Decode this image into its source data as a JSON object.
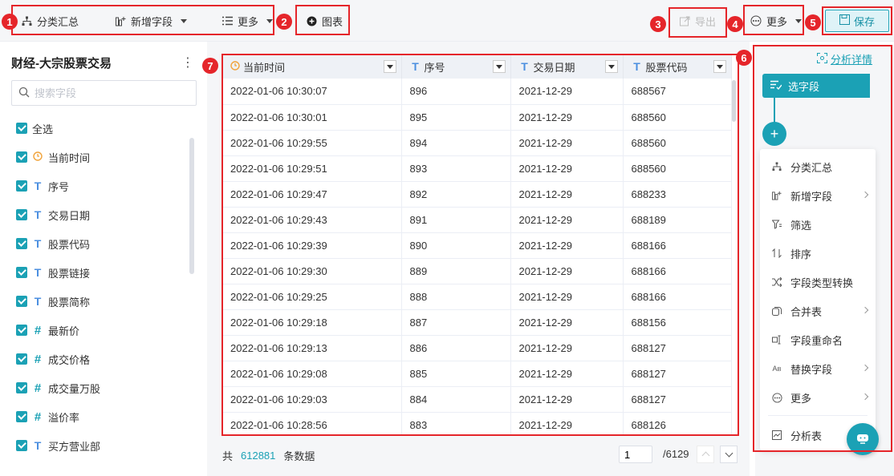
{
  "toolbar": {
    "group_summary": "分类汇总",
    "add_field": "新增字段",
    "more": "更多",
    "chart": "图表",
    "export": "导出",
    "more_right": "更多",
    "save": "保存"
  },
  "badges": [
    "1",
    "2",
    "3",
    "4",
    "5",
    "6",
    "7"
  ],
  "left_panel": {
    "title": "财经-大宗股票交易",
    "search_placeholder": "搜索字段",
    "select_all": "全选",
    "fields": [
      {
        "type": "time",
        "label": "当前时间"
      },
      {
        "type": "text",
        "label": "序号"
      },
      {
        "type": "text",
        "label": "交易日期"
      },
      {
        "type": "text",
        "label": "股票代码"
      },
      {
        "type": "text",
        "label": "股票链接"
      },
      {
        "type": "text",
        "label": "股票简称"
      },
      {
        "type": "number",
        "label": "最新价"
      },
      {
        "type": "number",
        "label": "成交价格"
      },
      {
        "type": "number",
        "label": "成交量万股"
      },
      {
        "type": "number",
        "label": "溢价率"
      },
      {
        "type": "text",
        "label": "买方营业部"
      }
    ]
  },
  "table": {
    "columns": [
      {
        "type": "time",
        "label": "当前时间"
      },
      {
        "type": "text",
        "label": "序号"
      },
      {
        "type": "text",
        "label": "交易日期"
      },
      {
        "type": "text",
        "label": "股票代码"
      }
    ],
    "rows": [
      [
        "2022-01-06 10:30:07",
        "896",
        "2021-12-29",
        "688567"
      ],
      [
        "2022-01-06 10:30:01",
        "895",
        "2021-12-29",
        "688560"
      ],
      [
        "2022-01-06 10:29:55",
        "894",
        "2021-12-29",
        "688560"
      ],
      [
        "2022-01-06 10:29:51",
        "893",
        "2021-12-29",
        "688560"
      ],
      [
        "2022-01-06 10:29:47",
        "892",
        "2021-12-29",
        "688233"
      ],
      [
        "2022-01-06 10:29:43",
        "891",
        "2021-12-29",
        "688189"
      ],
      [
        "2022-01-06 10:29:39",
        "890",
        "2021-12-29",
        "688166"
      ],
      [
        "2022-01-06 10:29:30",
        "889",
        "2021-12-29",
        "688166"
      ],
      [
        "2022-01-06 10:29:25",
        "888",
        "2021-12-29",
        "688166"
      ],
      [
        "2022-01-06 10:29:18",
        "887",
        "2021-12-29",
        "688156"
      ],
      [
        "2022-01-06 10:29:13",
        "886",
        "2021-12-29",
        "688127"
      ],
      [
        "2022-01-06 10:29:08",
        "885",
        "2021-12-29",
        "688127"
      ],
      [
        "2022-01-06 10:29:03",
        "884",
        "2021-12-29",
        "688127"
      ],
      [
        "2022-01-06 10:28:56",
        "883",
        "2021-12-29",
        "688126"
      ]
    ]
  },
  "footer": {
    "prefix": "共",
    "count": "612881",
    "suffix": "条数据",
    "page": "1",
    "total_pages": "/6129"
  },
  "right_panel": {
    "analysis_link": "分析详情",
    "current_step": "选字段",
    "menu": [
      {
        "label": "分类汇总",
        "icon": "hierarchy-icon",
        "sub": false
      },
      {
        "label": "新增字段",
        "icon": "add-field-icon",
        "sub": true
      },
      {
        "label": "筛选",
        "icon": "filter-icon",
        "sub": false
      },
      {
        "label": "排序",
        "icon": "sort-icon",
        "sub": false
      },
      {
        "label": "字段类型转换",
        "icon": "shuffle-icon",
        "sub": false
      },
      {
        "label": "合并表",
        "icon": "merge-icon",
        "sub": true
      },
      {
        "label": "字段重命名",
        "icon": "rename-icon",
        "sub": false
      },
      {
        "label": "替换字段",
        "icon": "replace-icon",
        "sub": true
      },
      {
        "label": "更多",
        "icon": "more-circle-icon",
        "sub": true
      },
      {
        "label": "分析表",
        "icon": "analysis-table-icon",
        "sub": false
      }
    ]
  },
  "colors": {
    "accent": "#1ba1b5",
    "annotation_red": "#e5252a",
    "text_type": "#4b8fe0",
    "time_type": "#f1a33b"
  }
}
